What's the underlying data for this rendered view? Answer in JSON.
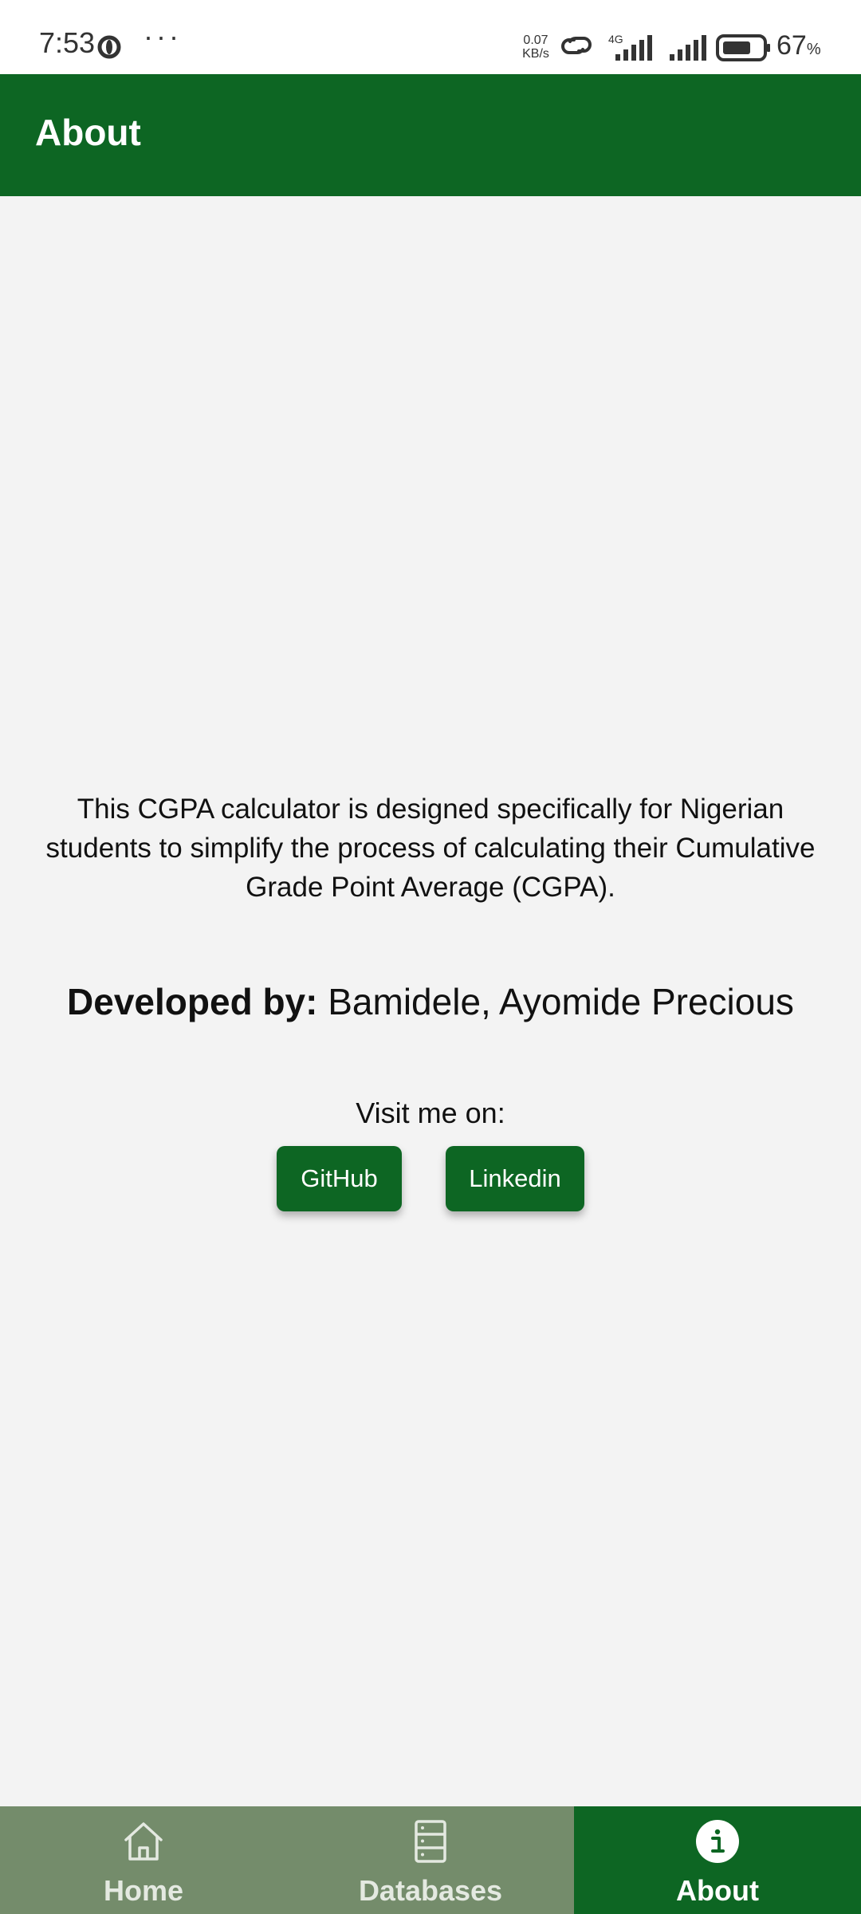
{
  "status_bar": {
    "time": "7:53",
    "more": "···",
    "net_speed_value": "0.07",
    "net_speed_unit": "KB/s",
    "network_type": "4G",
    "battery_level": "67",
    "battery_unit": "%",
    "icons": [
      "o-circle-icon",
      "link-icon",
      "signal-icon",
      "signal-icon",
      "battery-icon"
    ]
  },
  "app_bar": {
    "title": "About"
  },
  "content": {
    "description": "This CGPA calculator is designed specifically for Nigerian students to simplify the process of calculating their Cumulative Grade Point Average (CGPA).",
    "developer_label": "Developed by:",
    "developer_name": "Bamidele, Ayomide Precious",
    "visit_label": "Visit me on:",
    "github_label": "GitHub",
    "linkedin_label": "Linkedin"
  },
  "bottom_nav": {
    "items": [
      {
        "label": "Home",
        "icon": "home-icon",
        "active": false
      },
      {
        "label": "Databases",
        "icon": "database-icon",
        "active": false
      },
      {
        "label": "About",
        "icon": "info-icon",
        "active": true
      }
    ]
  },
  "colors": {
    "primary": "#0d6623",
    "nav_inactive_bg": "#748c6b",
    "background": "#f3f3f3"
  }
}
